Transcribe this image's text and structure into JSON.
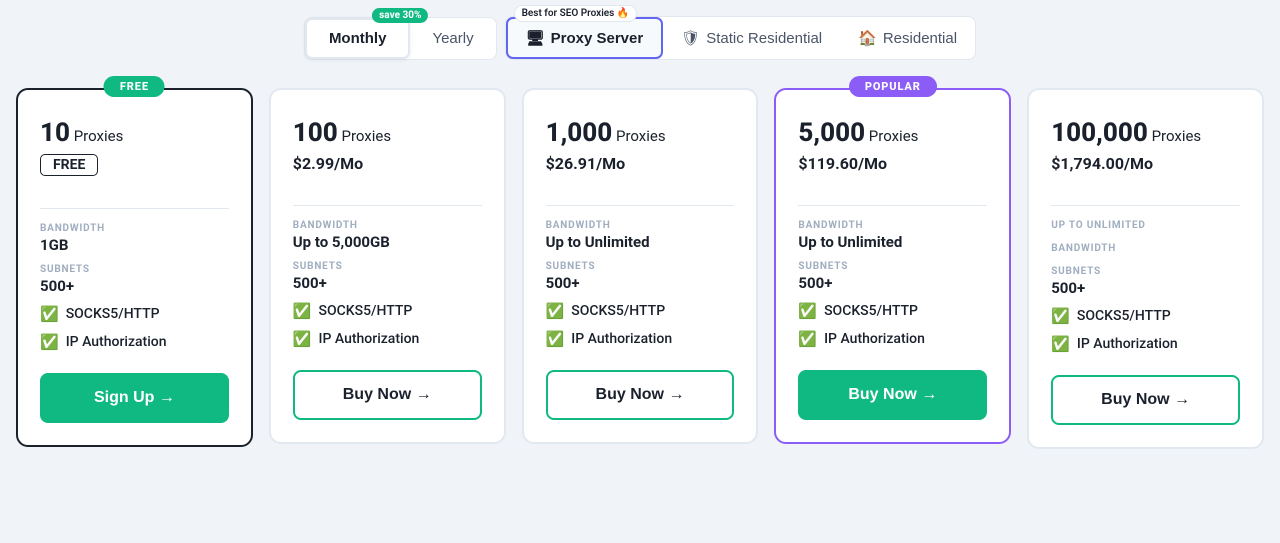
{
  "tabs": {
    "billing": {
      "save_badge": "save 30%",
      "monthly_label": "Monthly",
      "yearly_label": "Yearly"
    },
    "types": {
      "seo_badge": "Best for SEO Proxies 🔥",
      "options": [
        {
          "id": "proxy-server",
          "icon": "🖥",
          "label": "Proxy Server",
          "active": true
        },
        {
          "id": "static-residential",
          "icon": "🛡",
          "label": "Static Residential",
          "active": false
        },
        {
          "id": "residential",
          "icon": "🏠",
          "label": "Residential",
          "active": false
        }
      ]
    }
  },
  "cards": [
    {
      "id": "free",
      "badge": "FREE",
      "badge_type": "free",
      "proxies_count": "10",
      "proxies_label": "Proxies",
      "price": "FREE",
      "price_type": "tag",
      "bandwidth_label": "BANDWIDTH",
      "bandwidth_value": "1GB",
      "subnets_label": "SUBNETS",
      "subnets_value": "500+",
      "features": [
        "SOCKS5/HTTP",
        "IP Authorization"
      ],
      "btn_label": "Sign Up",
      "btn_arrow": "→",
      "btn_type": "primary"
    },
    {
      "id": "plan-100",
      "badge": null,
      "proxies_count": "100",
      "proxies_label": "Proxies",
      "price": "$2.99/Mo",
      "price_type": "text",
      "bandwidth_label": "BANDWIDTH",
      "bandwidth_value": "Up to 5,000GB",
      "subnets_label": "SUBNETS",
      "subnets_value": "500+",
      "features": [
        "SOCKS5/HTTP",
        "IP Authorization"
      ],
      "btn_label": "Buy Now",
      "btn_arrow": "→",
      "btn_type": "outline"
    },
    {
      "id": "plan-1000",
      "badge": null,
      "proxies_count": "1,000",
      "proxies_label": "Proxies",
      "price": "$26.91/Mo",
      "price_type": "text",
      "bandwidth_label": "BANDWIDTH",
      "bandwidth_value": "Up to Unlimited",
      "subnets_label": "SUBNETS",
      "subnets_value": "500+",
      "features": [
        "SOCKS5/HTTP",
        "IP Authorization"
      ],
      "btn_label": "Buy Now",
      "btn_arrow": "→",
      "btn_type": "outline"
    },
    {
      "id": "plan-5000",
      "badge": "POPULAR",
      "badge_type": "popular",
      "proxies_count": "5,000",
      "proxies_label": "Proxies",
      "price": "$119.60/Mo",
      "price_type": "text",
      "bandwidth_label": "BANDWIDTH",
      "bandwidth_value": "Up to Unlimited",
      "subnets_label": "SUBNETS",
      "subnets_value": "500+",
      "features": [
        "SOCKS5/HTTP",
        "IP Authorization"
      ],
      "btn_label": "Buy Now",
      "btn_arrow": "→",
      "btn_type": "popular"
    },
    {
      "id": "plan-100000",
      "badge": null,
      "proxies_count": "100,000",
      "proxies_label": "Proxies",
      "price": "$1,794.00/Mo",
      "price_type": "text",
      "bandwidth_label": "Up to Unlimited",
      "bandwidth_value": "",
      "bandwidth_label2": "BANDWIDTH",
      "subnets_label": "SUBNETS",
      "subnets_value": "500+",
      "features": [
        "SOCKS5/HTTP",
        "IP Authorization"
      ],
      "btn_label": "Buy Now",
      "btn_arrow": "→",
      "btn_type": "outline",
      "special_bandwidth": true
    }
  ]
}
